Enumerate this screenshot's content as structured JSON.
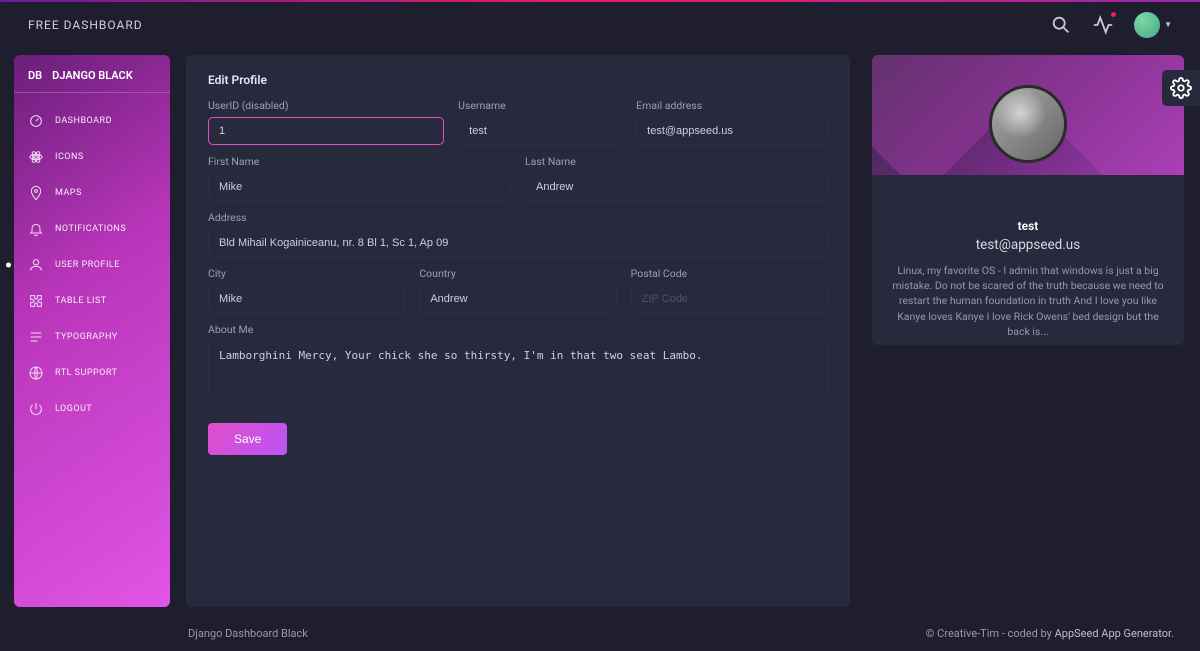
{
  "header": {
    "title": "FREE DASHBOARD"
  },
  "sidebar": {
    "short": "DB",
    "brand": "DJANGO BLACK",
    "items": [
      {
        "label": "DASHBOARD",
        "icon": "gauge"
      },
      {
        "label": "ICONS",
        "icon": "atom"
      },
      {
        "label": "MAPS",
        "icon": "pin"
      },
      {
        "label": "NOTIFICATIONS",
        "icon": "bell"
      },
      {
        "label": "USER PROFILE",
        "icon": "user",
        "active": true
      },
      {
        "label": "TABLE LIST",
        "icon": "puzzle"
      },
      {
        "label": "TYPOGRAPHY",
        "icon": "text"
      },
      {
        "label": "RTL SUPPORT",
        "icon": "globe"
      },
      {
        "label": "LOGOUT",
        "icon": "power"
      }
    ]
  },
  "form": {
    "title": "Edit Profile",
    "labels": {
      "userid": "UserID (disabled)",
      "username": "Username",
      "email": "Email address",
      "first": "First Name",
      "last": "Last Name",
      "address": "Address",
      "city": "City",
      "country": "Country",
      "postal": "Postal Code",
      "about": "About Me"
    },
    "values": {
      "userid": "1",
      "username": "test",
      "email": "test@appseed.us",
      "first": "Mike",
      "last": "Andrew",
      "address": "Bld Mihail Kogainiceanu, nr. 8 Bl 1, Sc 1, Ap 09",
      "city": "Mike",
      "country": "Andrew",
      "postal_placeholder": "ZIP Code",
      "about": "Lamborghini Mercy, Your chick she so thirsty, I'm in that two seat Lambo."
    },
    "save": "Save"
  },
  "profile": {
    "name": "test",
    "email": "test@appseed.us",
    "bio": "Linux, my favorite OS - I admin that windows is just a big mistake. Do not be scared of the truth because we need to restart the human foundation in truth And I love you like Kanye loves Kanye I love Rick Owens' bed design but the back is..."
  },
  "footer": {
    "left": "Django Dashboard Black",
    "right_prefix": "© Creative-Tim - coded by ",
    "right_link": "AppSeed App Generator",
    "right_suffix": "."
  }
}
